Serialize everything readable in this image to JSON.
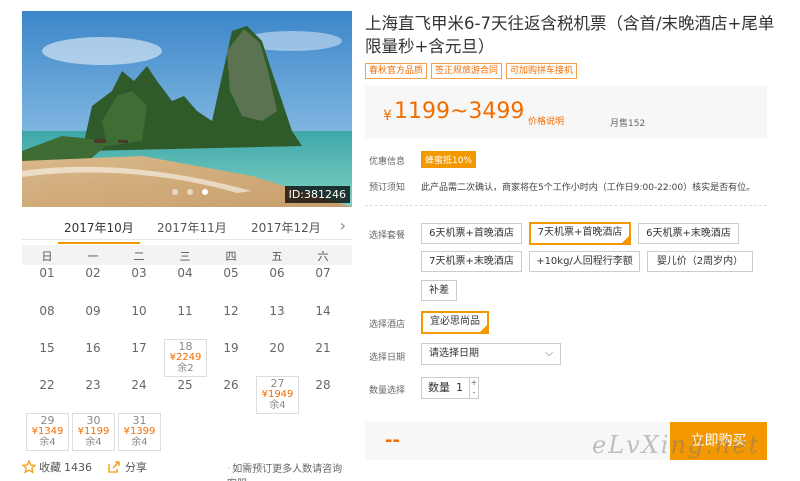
{
  "hero": {
    "image_id": "ID:381246"
  },
  "calendar": {
    "months": [
      "2017年10月",
      "2017年11月",
      "2017年12月"
    ],
    "weekdays": [
      "日",
      "一",
      "二",
      "三",
      "四",
      "五",
      "六"
    ],
    "rows": [
      [
        "01",
        "02",
        "03",
        "04",
        "05",
        "06",
        "07"
      ],
      [
        "08",
        "09",
        "10",
        "11",
        "12",
        "13",
        "14"
      ],
      [
        "15",
        "16",
        "17",
        "",
        "19",
        "20",
        "21"
      ],
      [
        "22",
        "23",
        "24",
        "25",
        "26",
        "",
        "28"
      ],
      [
        "",
        "",
        "",
        "",
        "",
        "",
        ""
      ]
    ],
    "priced": {
      "d18": {
        "day": "18",
        "price": "¥2249",
        "stock": "余2"
      },
      "d27": {
        "day": "27",
        "price": "¥1949",
        "stock": "余4"
      },
      "d29": {
        "day": "29",
        "price": "¥1349",
        "stock": "余4"
      },
      "d30": {
        "day": "30",
        "price": "¥1199",
        "stock": "余4"
      },
      "d31": {
        "day": "31",
        "price": "¥1399",
        "stock": "余4"
      }
    }
  },
  "footer": {
    "fav_label": "收藏",
    "fav_count": "1436",
    "share_label": "分享",
    "hint": "如需预订更多人数请咨询客服"
  },
  "product": {
    "title": "上海直飞甲米6-7天往返含税机票（含首/末晚酒店+尾单限量秒+含元旦）",
    "tags": [
      "春秋官方品质",
      "签正规旅游合同",
      "可加购拼车接机"
    ],
    "price_symbol": "¥",
    "price_range": "1199~3499",
    "price_note": "价格说明",
    "monthly_sales": "月售152"
  },
  "info": {
    "promo_label": "优惠信息",
    "promo_badge": "蜂蜜抵10%",
    "notice_label": "预订须知",
    "notice_text": "此产品需二次确认，商家将在5个工作小时内（工作日9:00-22:00）核实是否有位。"
  },
  "options": {
    "package_label": "选择套餐",
    "packages": [
      "6天机票+首晚酒店",
      "7天机票+首晚酒店",
      "6天机票+末晚酒店",
      "7天机票+末晚酒店",
      "+10kg/人回程行李额",
      "婴儿价（2周岁内）",
      "补差"
    ],
    "hotel_label": "选择酒店",
    "hotel": "宜必思尚品",
    "date_label": "选择日期",
    "date_placeholder": "请选择日期",
    "qty_label": "数量选择",
    "qty_text": "数量",
    "qty_value": "1"
  },
  "buy": {
    "price_placeholder": "--",
    "button": "立即购买"
  },
  "watermark": "eLvXing.net"
}
